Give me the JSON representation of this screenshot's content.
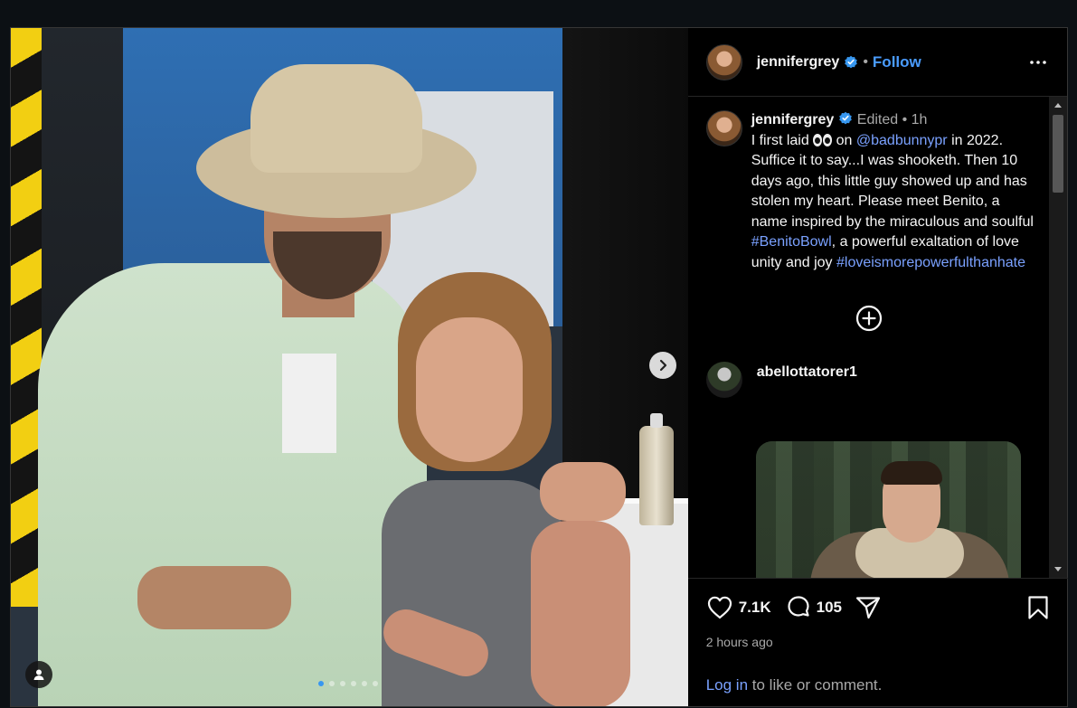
{
  "post": {
    "username": "jennifergrey",
    "follow_label": "Follow",
    "separator": "•",
    "caption": {
      "username": "jennifergrey",
      "edited": "Edited",
      "dot": "•",
      "time": "1h",
      "part1": "I first laid ",
      "part2": " on ",
      "mention": "@badbunnypr",
      "part3": " in 2022. Suffice it to say...I was shooketh. Then 10 days ago, this little guy showed up and has stolen my heart. Please meet Benito, a name inspired by the miraculous and soulful ",
      "hashtag1": "#BenitoBowl",
      "part4": ", a powerful exaltation of love unity and joy  ",
      "hashtag2": "#loveismorepowerfulthanhate"
    },
    "comment": {
      "username": "abellottatorer1"
    },
    "likes": "7.1K",
    "comments_count": "105",
    "time_ago": "2 hours ago",
    "login_link": "Log in",
    "login_suffix": " to like or comment."
  },
  "media": {
    "carousel_count": 6,
    "carousel_active_index": 0
  },
  "colors": {
    "accent": "#4a9cff",
    "link": "#7aa1ff",
    "background": "#000000",
    "verified": "#3797f0"
  },
  "icons": [
    "verified-icon",
    "more-options-icon",
    "add-comment-icon",
    "heart-icon",
    "comment-icon",
    "share-icon",
    "bookmark-icon",
    "chevron-right-icon",
    "user-tag-icon",
    "scroll-up-icon",
    "scroll-down-icon",
    "eyes-emoji-icon"
  ]
}
